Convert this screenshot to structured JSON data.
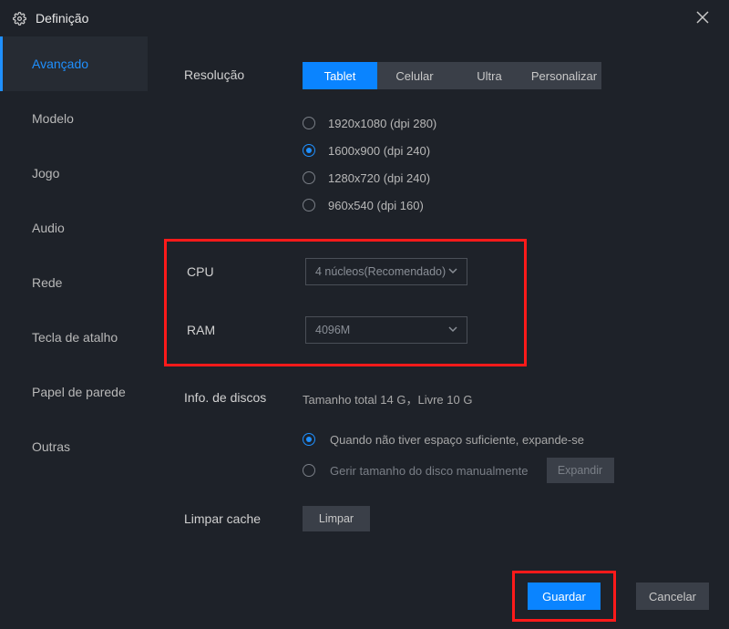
{
  "title": "Definição",
  "sidebar": {
    "items": [
      {
        "label": "Avançado"
      },
      {
        "label": "Modelo"
      },
      {
        "label": "Jogo"
      },
      {
        "label": "Audio"
      },
      {
        "label": "Rede"
      },
      {
        "label": "Tecla de atalho"
      },
      {
        "label": "Papel de parede"
      },
      {
        "label": "Outras"
      }
    ],
    "active_index": 0
  },
  "resolution": {
    "label": "Resolução",
    "tabs": [
      "Tablet",
      "Celular",
      "Ultra",
      "Personalizar"
    ],
    "active_tab": 0,
    "options": [
      "1920x1080  (dpi 280)",
      "1600x900  (dpi 240)",
      "1280x720  (dpi 240)",
      "960x540  (dpi 160)"
    ],
    "selected_option": 1
  },
  "cpu": {
    "label": "CPU",
    "value": "4 núcleos(Recomendado)"
  },
  "ram": {
    "label": "RAM",
    "value": "4096M"
  },
  "disk": {
    "label": "Info. de discos",
    "summary": "Tamanho total 14 G，Livre 10 G",
    "options": [
      "Quando não tiver espaço suficiente, expande-se",
      "Gerir tamanho do disco manualmente"
    ],
    "selected_option": 0,
    "expand_button": "Expandir"
  },
  "cache": {
    "label": "Limpar cache",
    "button": "Limpar"
  },
  "footer": {
    "save": "Guardar",
    "cancel": "Cancelar"
  }
}
